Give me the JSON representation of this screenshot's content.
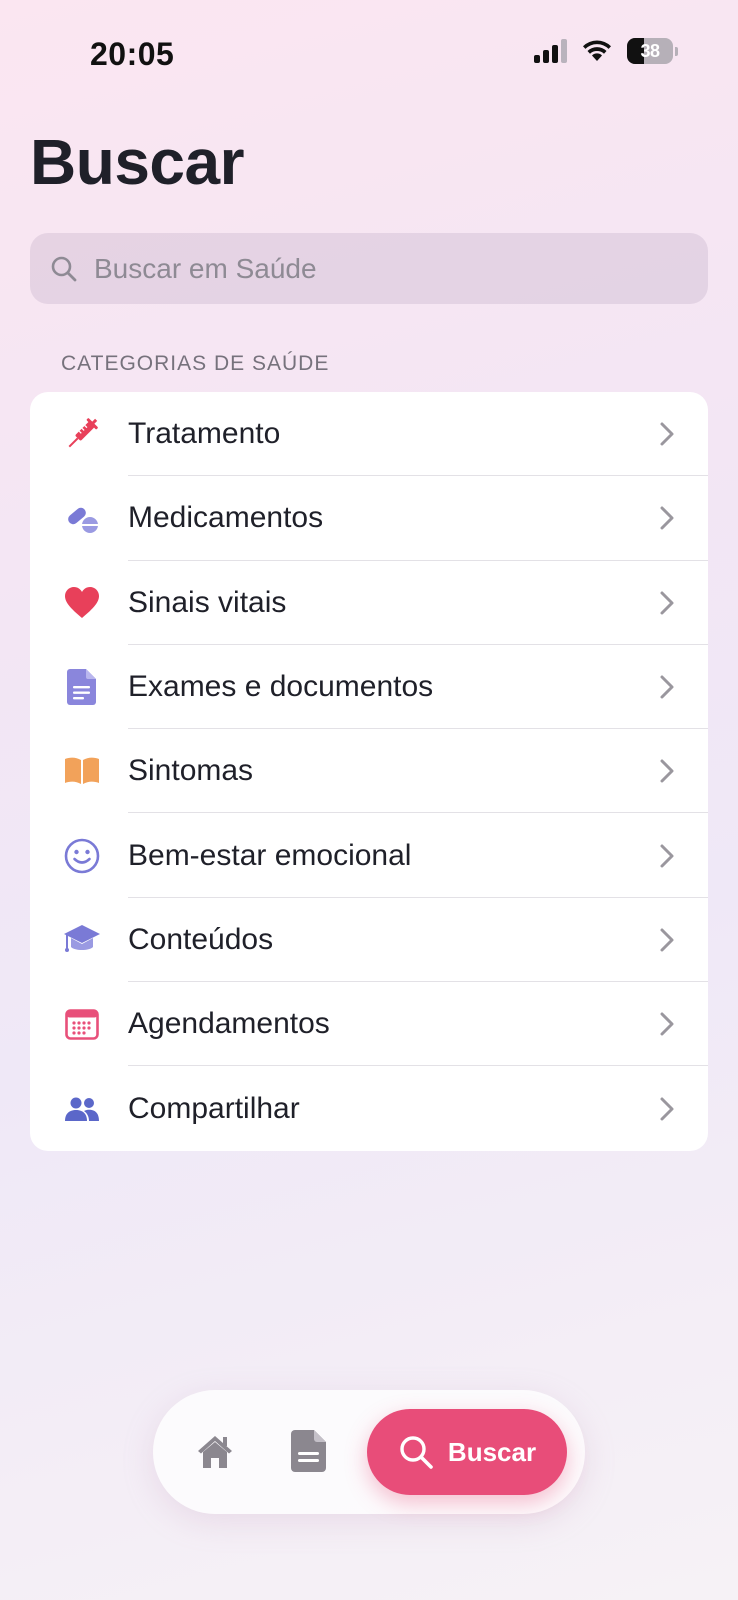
{
  "status_bar": {
    "time": "20:05",
    "battery": "38"
  },
  "page": {
    "title": "Buscar"
  },
  "search": {
    "placeholder": "Buscar em Saúde"
  },
  "categories": {
    "header": "CATEGORIAS DE SAÚDE",
    "items": [
      {
        "label": "Tratamento",
        "icon": "syringe-icon",
        "color": "#e8405a"
      },
      {
        "label": "Medicamentos",
        "icon": "pills-icon",
        "color": "#7a7ad6"
      },
      {
        "label": "Sinais vitais",
        "icon": "heart-icon",
        "color": "#e8405a"
      },
      {
        "label": "Exames e documentos",
        "icon": "document-icon",
        "color": "#8a86dc"
      },
      {
        "label": "Sintomas",
        "icon": "book-icon",
        "color": "#f2a25a"
      },
      {
        "label": "Bem-estar emocional",
        "icon": "smiley-icon",
        "color": "#7a7ad6"
      },
      {
        "label": "Conteúdos",
        "icon": "graduation-cap-icon",
        "color": "#7a7ad6"
      },
      {
        "label": "Agendamentos",
        "icon": "calendar-icon",
        "color": "#e8507a"
      },
      {
        "label": "Compartilhar",
        "icon": "people-icon",
        "color": "#5b67c9"
      }
    ]
  },
  "tab_bar": {
    "items": [
      {
        "icon": "home-icon"
      },
      {
        "icon": "document-icon"
      },
      {
        "icon": "search-icon",
        "label": "Buscar",
        "active": true
      }
    ],
    "active_color": "#e84d79"
  }
}
